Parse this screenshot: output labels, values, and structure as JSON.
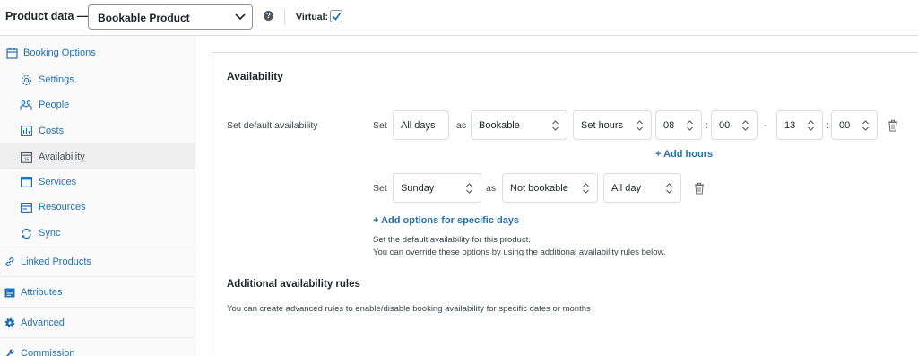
{
  "header": {
    "title": "Product data —",
    "product_type": "Bookable Product",
    "help": "?",
    "virtual_label": "Virtual:",
    "virtual_checked": true
  },
  "sidebar": {
    "items": [
      {
        "label": "Booking Options",
        "icon": "calendar-icon"
      },
      {
        "label": "Settings",
        "icon": "gear-icon"
      },
      {
        "label": "People",
        "icon": "people-icon"
      },
      {
        "label": "Costs",
        "icon": "bar-chart-icon"
      },
      {
        "label": "Availability",
        "icon": "calendar-day-icon",
        "active": true
      },
      {
        "label": "Services",
        "icon": "window-icon"
      },
      {
        "label": "Resources",
        "icon": "card-icon"
      },
      {
        "label": "Sync",
        "icon": "sync-icon"
      },
      {
        "label": "Linked Products",
        "icon": "link-icon"
      },
      {
        "label": "Attributes",
        "icon": "list-icon"
      },
      {
        "label": "Advanced",
        "icon": "gear-solid-icon"
      },
      {
        "label": "Commission",
        "icon": "wrench-icon"
      }
    ]
  },
  "availability": {
    "heading": "Availability",
    "default_label": "Set default availability",
    "row1": {
      "set": "Set",
      "days": "All days",
      "as": "as",
      "status": "Bookable",
      "mode": "Set hours",
      "from_h": "08",
      "colon": ":",
      "from_m": "00",
      "dash": "-",
      "to_h": "13",
      "to_m": "00"
    },
    "add_hours": "+ Add hours",
    "row2": {
      "set": "Set",
      "day": "Sunday",
      "as": "as",
      "status": "Not bookable",
      "mode": "All day"
    },
    "add_options": "+ Add options for specific days",
    "note1": "Set the default availability for this product.",
    "note2": "You can override these options by using the additional availability rules below."
  },
  "rules": {
    "heading": "Additional availability rules",
    "description": "You can create advanced rules to enable/disable booking availability for specific dates or months"
  },
  "colors": {
    "link": "#2271b1",
    "text": "#1d2327",
    "border": "#dcdcde",
    "sidebar_bg": "#fafafa",
    "active_bg": "#eeeeee"
  }
}
